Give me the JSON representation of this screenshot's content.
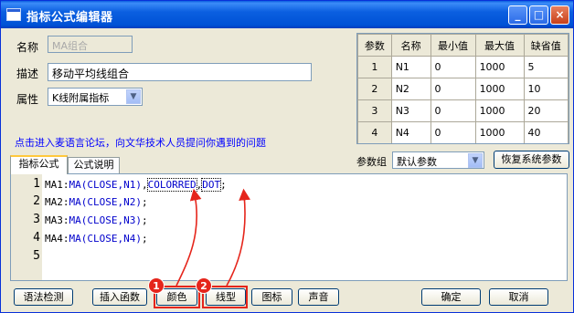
{
  "window": {
    "title": "指标公式编辑器",
    "min": "_",
    "max": "□",
    "close": "×"
  },
  "form": {
    "name_label": "名称",
    "name_value": "MA组合",
    "desc_label": "描述",
    "desc_value": "移动平均线组合",
    "attr_label": "属性",
    "attr_value": "K线附属指标"
  },
  "link_text": "点击进入麦语言论坛，向文华技术人员提问你遇到的问题",
  "params": {
    "headers": [
      "参数",
      "名称",
      "最小值",
      "最大值",
      "缺省值"
    ],
    "rows": [
      [
        "1",
        "N1",
        "0",
        "1000",
        "5"
      ],
      [
        "2",
        "N2",
        "0",
        "1000",
        "10"
      ],
      [
        "3",
        "N3",
        "0",
        "1000",
        "20"
      ],
      [
        "4",
        "N4",
        "0",
        "1000",
        "40"
      ]
    ],
    "group_label": "参数组",
    "group_value": "默认参数",
    "restore_label": "恢复系统参数"
  },
  "tabs": [
    "指标公式",
    "公式说明"
  ],
  "editor": {
    "line_numbers": [
      "1",
      "2",
      "3",
      "4",
      "5"
    ],
    "lines": [
      {
        "name": "MA1:",
        "fn": "MA(CLOSE,N1)",
        "extra1": "COLORRED",
        "extra2": "DOT",
        "end": ";"
      },
      {
        "name": "MA2:",
        "fn": "MA(CLOSE,N2)",
        "end": ";"
      },
      {
        "name": "MA3:",
        "fn": "MA(CLOSE,N3)",
        "end": ";"
      },
      {
        "name": "MA4:",
        "fn": "MA(CLOSE,N4)",
        "end": ";"
      }
    ]
  },
  "buttons": {
    "syntax": "语法检测",
    "insert_fn": "插入函数",
    "color": "颜色",
    "line_type": "线型",
    "icon": "图标",
    "sound": "声音",
    "ok": "确定",
    "cancel": "取消"
  },
  "annotations": {
    "marker1": "1",
    "marker2": "2",
    "accent": "#e5251b"
  }
}
